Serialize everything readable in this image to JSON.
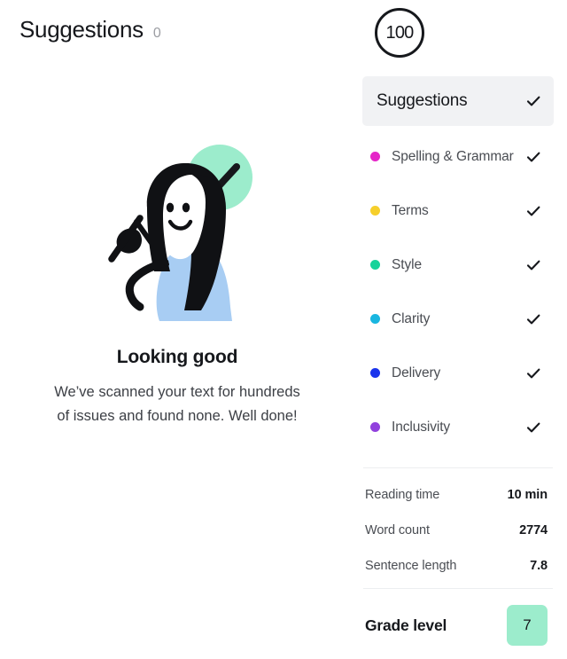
{
  "left": {
    "header": {
      "title": "Suggestions",
      "count": "0"
    },
    "empty_state": {
      "illustration_name": "person-writing-with-check-illustration",
      "title": "Looking good",
      "body": "We’ve scanned your text for hundreds of issues and found none. Well done!"
    }
  },
  "right": {
    "score": {
      "value": "100",
      "ring_color": "#16181c"
    },
    "categories_header": {
      "label": "Suggestions",
      "check_icon": "check-icon",
      "background": "#f1f2f4"
    },
    "categories": [
      {
        "label": "Spelling & Grammar",
        "dot_color": "#e526c8",
        "check_icon": "check-icon"
      },
      {
        "label": "Terms",
        "dot_color": "#f6cf2b",
        "check_icon": "check-icon"
      },
      {
        "label": "Style",
        "dot_color": "#16d39a",
        "check_icon": "check-icon"
      },
      {
        "label": "Clarity",
        "dot_color": "#19b6e0",
        "check_icon": "check-icon"
      },
      {
        "label": "Delivery",
        "dot_color": "#1a34ec",
        "check_icon": "check-icon"
      },
      {
        "label": "Inclusivity",
        "dot_color": "#9141dd",
        "check_icon": "check-icon"
      }
    ],
    "stats": [
      {
        "label": "Reading time",
        "value": "10 min"
      },
      {
        "label": "Word count",
        "value": "2774"
      },
      {
        "label": "Sentence length",
        "value": "7.8"
      }
    ],
    "grade": {
      "label": "Grade level",
      "value": "7",
      "badge_color": "#9ceccc"
    }
  },
  "theme": {
    "mint": "#9ceccc",
    "shirt_blue": "#a8cdf3",
    "ink": "#16181c",
    "muted": "#9c9ea3",
    "panel_gray": "#f1f2f4"
  }
}
